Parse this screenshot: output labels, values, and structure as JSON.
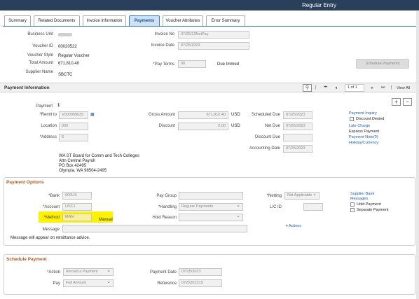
{
  "header": {
    "title": "Regular Entry"
  },
  "tabs": [
    {
      "label": "Summary"
    },
    {
      "label": "Related Documents"
    },
    {
      "label": "Invoice Information"
    },
    {
      "label": "Payments"
    },
    {
      "label": "Voucher Attributes"
    },
    {
      "label": "Error Summary"
    }
  ],
  "voucher": {
    "business_unit_label": "Business Unit",
    "voucher_id_label": "Voucher ID",
    "voucher_id": "00020522",
    "voucher_style_label": "Voucher Style",
    "voucher_style": "Regular Voucher",
    "total_amount_label": "Total Amount",
    "total_amount": "671,810.40",
    "supplier_name_label": "Supplier Name",
    "supplier_name": "SBCTC",
    "invoice_no_label": "Invoice No",
    "invoice_no": "07/25/23NetPay",
    "invoice_date_label": "Invoice Date",
    "invoice_date": "07/25/2023",
    "pay_terms_label": "*Pay Terms",
    "pay_terms": "00",
    "pay_terms_desc": "Due Immed",
    "schedule_payments_label": "Schedule Payments"
  },
  "payment_info": {
    "title": "Payment Information",
    "pager": "1 of 1",
    "view_all": "View All",
    "payment_label": "Payment",
    "payment_number": "1",
    "remit_to_label": "*Remit to",
    "remit_to": "V000009035",
    "location_label": "Location",
    "location": "000",
    "address_label": "*Address",
    "address": "6",
    "address_lines": [
      "WA ST Board for Comm and Tech Colleges",
      "Attn Central Payroll",
      "PO Box 42495",
      "Olympia, WA  98504-2495"
    ],
    "gross_amount_label": "Gross Amount",
    "gross_amount": "671,810.40",
    "discount_label": "Discount",
    "discount": "0.00",
    "currency": "USD",
    "scheduled_due_label": "Scheduled Due",
    "scheduled_due": "07/25/2023",
    "net_due_label": "Net Due",
    "net_due": "07/25/2023",
    "discount_due_label": "Discount Due",
    "accounting_date_label": "Accounting Date",
    "accounting_date": "07/25/2023",
    "links": {
      "payment_inquiry": "Payment Inquiry",
      "discount_denied": "Discount Denied",
      "late_charge": "Late Charge",
      "express_payment": "Express Payment",
      "payment_note": "Payment Note(0)",
      "holiday_currency": "Holiday/Currency"
    }
  },
  "payment_options": {
    "title": "Payment Options",
    "bank_label": "*Bank",
    "bank": "000US",
    "account_label": "*Account",
    "account": "USC1",
    "method_label": "*Method",
    "method": "MAN",
    "method_desc": "Manual",
    "message_label": "Message",
    "pay_group_label": "Pay Group",
    "handling_label": "*Handling",
    "handling": "Regular Payments",
    "hold_reason_label": "Hold Reason",
    "netting_label": "*Netting",
    "netting": "Not Applicable",
    "lc_id_label": "L/C ID",
    "supplier_bank_messages": "Supplier Bank Messages",
    "hold_payment": "Hold Payment",
    "separate_payment": "Separate Payment",
    "actions": "Actions",
    "remittance_note": "Message will appear on remittance advice."
  },
  "schedule_payment": {
    "title": "Schedule Payment",
    "action_label": "*Action",
    "action": "Record a Payment",
    "pay_label": "Pay",
    "pay": "Full Amount",
    "payment_date_label": "Payment Date",
    "payment_date": "07/25/2023",
    "reference_label": "Reference",
    "reference": "072520231S"
  },
  "colors": {
    "topbar": "#29405a",
    "highlight": "#fff200",
    "section_header": "#b05a1e",
    "link": "#1f5fa8"
  }
}
